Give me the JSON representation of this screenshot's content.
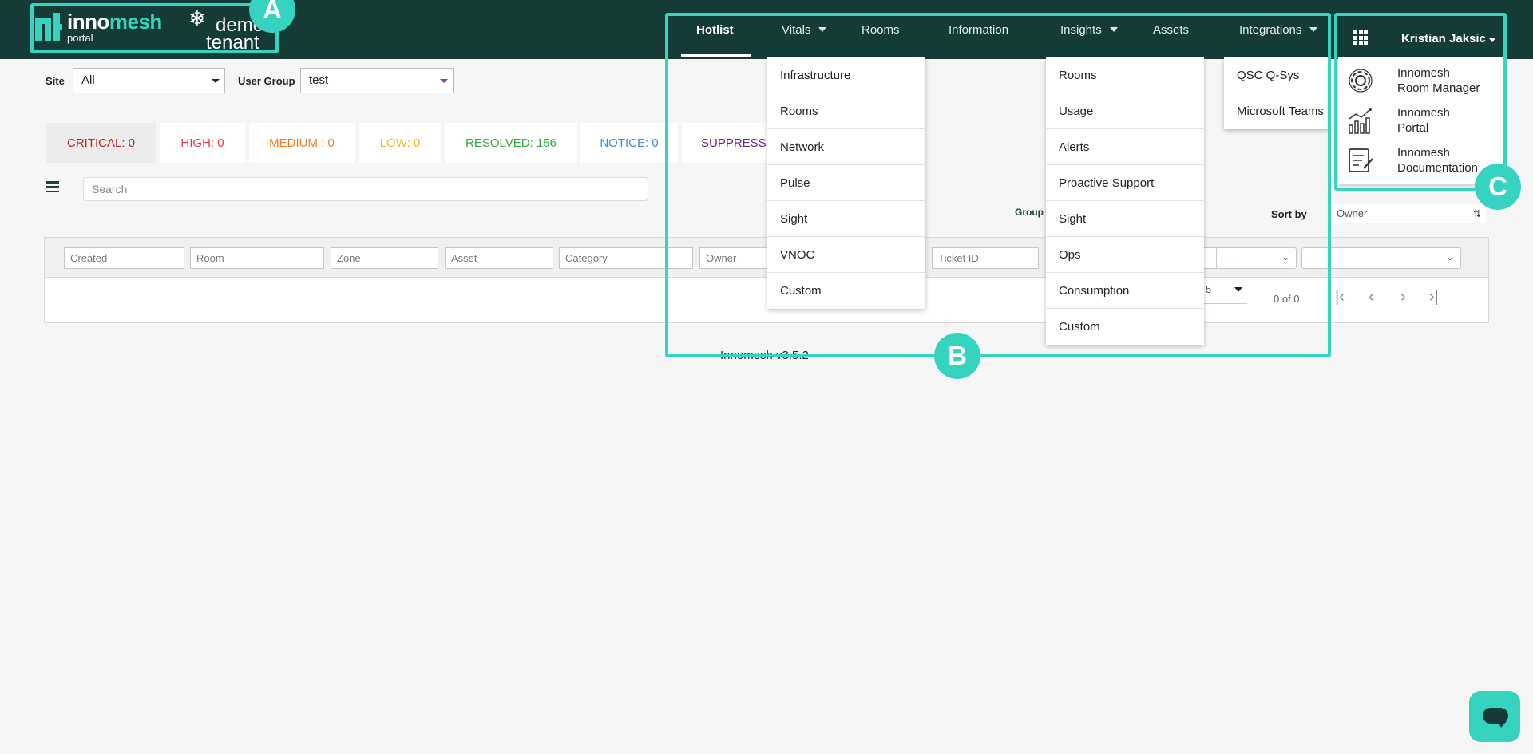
{
  "header": {
    "logo": {
      "name_part1": "inno",
      "name_part2": "mesh",
      "sub": "portal"
    },
    "tenant": {
      "line1": "demo",
      "line2": "tenant"
    },
    "nav": [
      {
        "label": "Hotlist",
        "active": true
      },
      {
        "label": "Vitals",
        "has_dropdown": true
      },
      {
        "label": "Rooms"
      },
      {
        "label": "Information"
      },
      {
        "label": "Insights",
        "has_dropdown": true
      },
      {
        "label": "Assets"
      },
      {
        "label": "Integrations",
        "has_dropdown": true
      }
    ],
    "apps_icon": "grid-icon",
    "user": "Kristian Jaksic"
  },
  "filters": {
    "site_label": "Site",
    "site_value": "All",
    "user_group_label": "User Group",
    "user_group_value": "test"
  },
  "severity": [
    {
      "label": "CRITICAL: 0",
      "color": "#b3261e"
    },
    {
      "label": "HIGH: 0",
      "color": "#e53950"
    },
    {
      "label": "MEDIUM : 0",
      "color": "#f57c1f"
    },
    {
      "label": "LOW: 0",
      "color": "#f5b324"
    },
    {
      "label": "RESOLVED: 156",
      "color": "#2eaa3c"
    },
    {
      "label": "NOTICE: 0",
      "color": "#3a8fd0"
    },
    {
      "label": "SUPPRESS",
      "color": "#5b2a86"
    }
  ],
  "search": {
    "placeholder": "Search"
  },
  "group_label": "Group",
  "sort": {
    "label": "Sort by",
    "value": "Owner"
  },
  "table": {
    "column_filters": [
      "Created",
      "Room",
      "Zone",
      "Asset",
      "Category",
      "Owner",
      "Ticket ID"
    ],
    "select_filters": [
      "---",
      "---"
    ],
    "page_size": "5",
    "page_count": "0 of 0"
  },
  "version": "Innomesh v3.5.2",
  "menus": {
    "vitals": [
      "Infrastructure",
      "Rooms",
      "Network",
      "Pulse",
      "Sight",
      "VNOC",
      "Custom"
    ],
    "insights": [
      "Rooms",
      "Usage",
      "Alerts",
      "Proactive Support",
      "Sight",
      "Ops",
      "Consumption",
      "Custom"
    ],
    "integrations": [
      "QSC Q-Sys",
      "Microsoft Teams"
    ],
    "apps": [
      {
        "line1": "Innomesh",
        "line2": "Room Manager",
        "icon": "gear-icon"
      },
      {
        "line1": "Innomesh",
        "line2": "Portal",
        "icon": "chart-icon"
      },
      {
        "line1": "Innomesh",
        "line2": "Documentation",
        "icon": "document-icon"
      }
    ]
  },
  "annotations": [
    "A",
    "B",
    "C"
  ],
  "colors": {
    "header": "#143b35",
    "accent": "#35d3c0"
  }
}
